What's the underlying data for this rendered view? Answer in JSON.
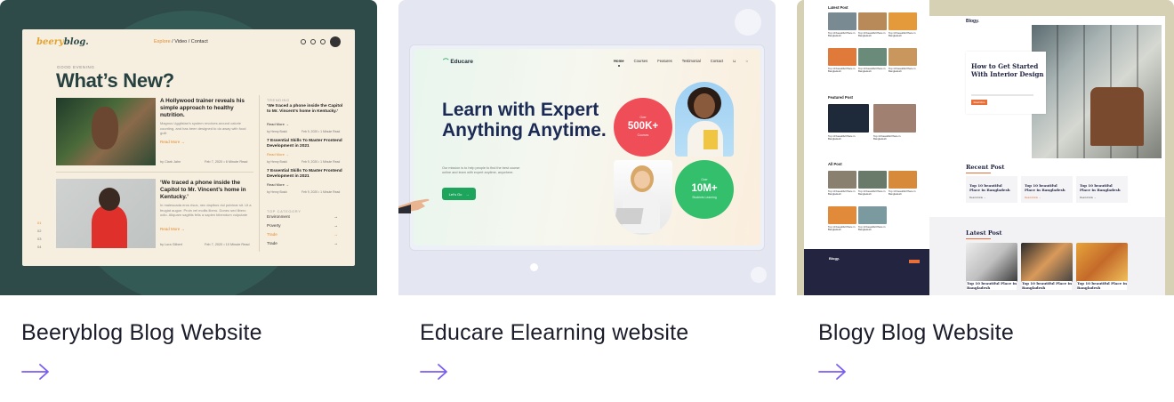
{
  "cards": [
    {
      "title": "Beeryblog Blog Website",
      "preview": {
        "logo_a": "beery",
        "logo_b": "blog.",
        "nav_active": "Explore",
        "nav_rest": " / Video / Contact",
        "greeting": "GOOD EVENING",
        "heading": "What’s New?",
        "post1_title": "A Hollywood trainer reveals his simple approach to healthy nutrition.",
        "post1_excerpt": "Magnus Ugglistan's system revolves around calorie counting, and has been designed to do away with food guilt",
        "post1_author": "by Clark Jahn",
        "post1_date": "Feb 7, 2020 • 6 Minute Read",
        "post2_title": "‘We traced a phone inside the Capitol to Mr. Vincent’s home in Kentucky.’",
        "post2_excerpt": "In malesuada eros risus, nec dapibus dui pulvinar sit. Ut a feugiat augue. Proin vel mollis libero. Donec sed libero odio. Aliquam sagittis felis a sapien bibendum vulputate",
        "post2_author": "by Lura Gilbert",
        "post2_date": "Feb 7, 2020 • 10 Minute Read",
        "read_more": "Read More →",
        "trending_label": "TRENDING",
        "trend1": "‘We traced a phone inside the Capitol to Mr. Vincent’s home in Kentucky.’",
        "trend2": "7 Essential Skills To Master Frontend Development in 2021",
        "trend3": "‘We traced a phone inside the Capitol to Mr. Vincent’s home in Kentucky.’",
        "trend_author": "by Henry Boski",
        "trend_date": "Feb 9, 2020 • 1 Minute Read",
        "top_category_label": "TOP CATEGORY",
        "categories": [
          "Environment",
          "Poverty",
          "Trade",
          "Trade"
        ],
        "pager": [
          "01",
          "02",
          "03",
          "04"
        ]
      }
    },
    {
      "title": "Educare Elearning website",
      "preview": {
        "logo": "Educare",
        "nav": [
          "Home",
          "Courses",
          "Features",
          "Testimonial",
          "Contact"
        ],
        "heading": "Learn with Expert Anything Anytime.",
        "subtext": "Our mission is to help people to find the best course online and learn with expert anytime, anywhere.",
        "button": "Let’s Go",
        "stat1_label": "Over",
        "stat1_value": "500K+",
        "stat1_caption": "Courses",
        "stat2_label": "Over",
        "stat2_value": "10M+",
        "stat2_caption": "Students Learning"
      }
    },
    {
      "title": "Blogy Blog Website",
      "preview": {
        "logo": "Blogy.",
        "latest_post_label": "Latest Post",
        "featured_post_label": "Featured Post",
        "all_post_label": "All Post",
        "tile_caption": "Top 10 beautiful Place in Bangladesh",
        "hero_title": "How to Get Started With Interior Design",
        "hero_button": "Read More",
        "recent_post_heading": "Recent Post",
        "latest_post_heading": "Latest Post",
        "post_title": "Top 10 beautiful Place in Bangladesh",
        "read_article": "Read Article →"
      }
    }
  ],
  "arrow_icon": "arrow-right-icon",
  "colors": {
    "accent_arrow": "#7b5cf0",
    "beery_bg": "#2e4b4a",
    "educare_green": "#1ea55c",
    "educare_red": "#ef4d58",
    "blogy_bg": "#d6d0b4"
  }
}
